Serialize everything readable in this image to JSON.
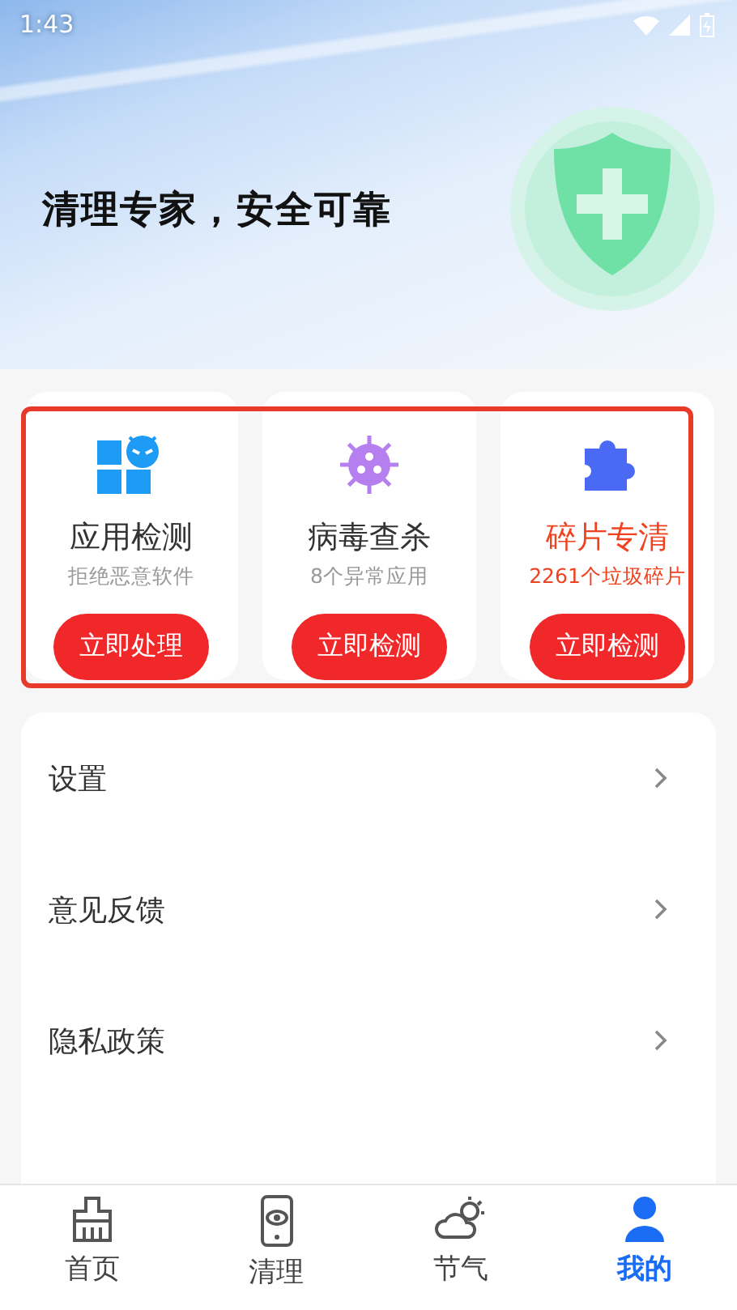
{
  "status_bar": {
    "time": "1:43"
  },
  "header": {
    "slogan": "清理专家，安全可靠"
  },
  "features": [
    {
      "kind": "app",
      "title": "应用检测",
      "subtitle": "拒绝恶意软件",
      "button": "立即处理",
      "alert": false
    },
    {
      "kind": "virus",
      "title": "病毒查杀",
      "subtitle": "8个异常应用",
      "button": "立即检测",
      "alert": false
    },
    {
      "kind": "fragment",
      "title": "碎片专清",
      "subtitle": "2261个垃圾碎片",
      "button": "立即检测",
      "alert": true
    }
  ],
  "menu": [
    {
      "label": "设置"
    },
    {
      "label": "意见反馈"
    },
    {
      "label": "隐私政策"
    }
  ],
  "tabs": [
    {
      "kind": "broom",
      "label": "首页",
      "selected": false
    },
    {
      "kind": "phone",
      "label": "清理",
      "selected": false
    },
    {
      "kind": "weather",
      "label": "节气",
      "selected": false
    },
    {
      "kind": "user",
      "label": "我的",
      "selected": true
    }
  ]
}
